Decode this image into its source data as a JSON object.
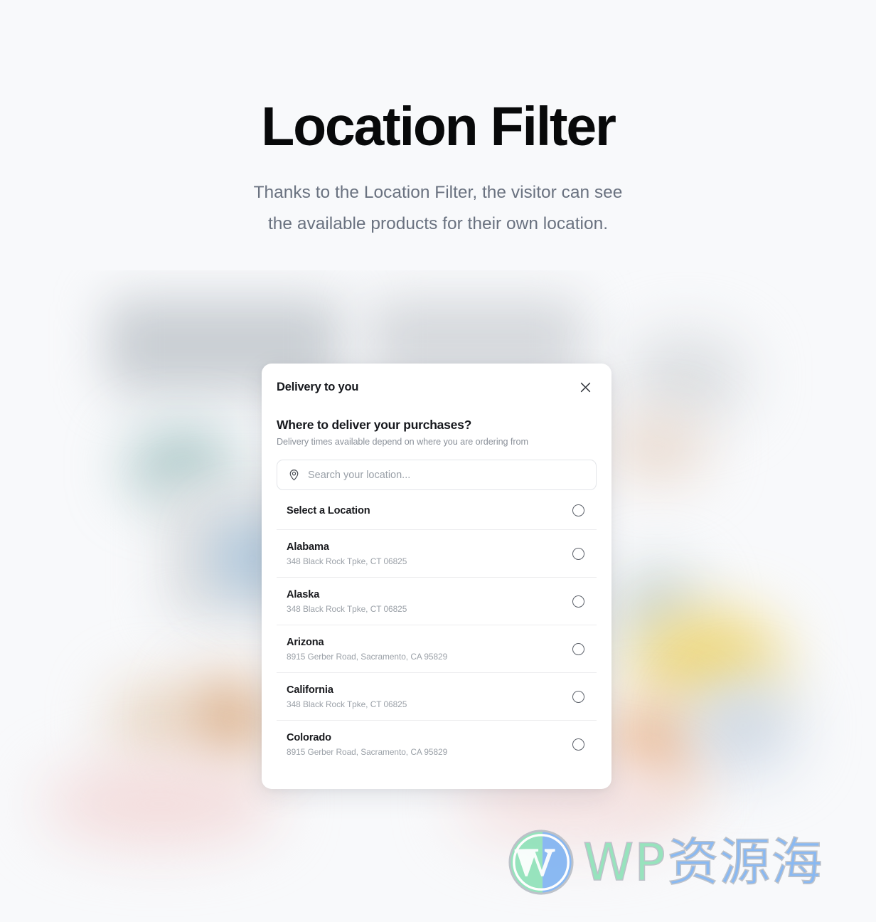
{
  "page": {
    "background_color": "#f8f9fb"
  },
  "hero": {
    "title": "Location Filter",
    "subtitle_line1": "Thanks to the Location Filter, the visitor can see",
    "subtitle_line2": "the available products for their own location.",
    "title_color": "#08090a",
    "subtitle_color": "#6a7280"
  },
  "modal": {
    "header_title": "Delivery to you",
    "close_icon": "close-icon",
    "question_title": "Where to deliver your purchases?",
    "question_subtitle": "Delivery times available depend on where you are ordering from",
    "search": {
      "icon": "map-pin-icon",
      "placeholder": "Search your location...",
      "value": ""
    },
    "list_header": {
      "label": "Select a Location",
      "selected": false
    },
    "locations": [
      {
        "name": "Alabama",
        "address": "348 Black Rock Tpke, CT 06825",
        "selected": false
      },
      {
        "name": "Alaska",
        "address": "348 Black Rock Tpke, CT 06825",
        "selected": false
      },
      {
        "name": "Arizona",
        "address": "8915 Gerber Road, Sacramento, CA 95829",
        "selected": false
      },
      {
        "name": "California",
        "address": "348 Black Rock Tpke, CT 06825",
        "selected": false
      },
      {
        "name": "Colorado",
        "address": "8915 Gerber Road, Sacramento, CA 95829",
        "selected": false
      }
    ]
  },
  "watermark": {
    "logo_icon": "wordpress-logo-icon",
    "text_latin": "WP",
    "text_cjk": "资源海",
    "color_latin": "#8fe2b9",
    "color_cjk": "#81b4f2"
  }
}
